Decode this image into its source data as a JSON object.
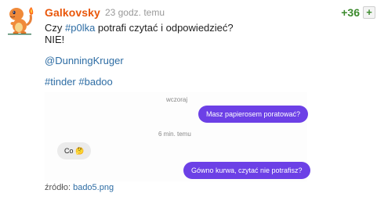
{
  "post": {
    "username": "Galkovsky",
    "time": "23 godz. temu",
    "votes": "+36",
    "plus_label": "+",
    "body": {
      "line1_prefix": "Czy ",
      "line1_tag": "#p0lka",
      "line1_suffix": " potrafi czytać i odpowiedzieć?",
      "line2": "NIE!",
      "mention": "@DunningKruger",
      "tag1": "#tinder",
      "tag2": "#badoo"
    },
    "image": {
      "day_label_1": "wczoraj",
      "message_out_1": "Masz papierosem poratować?",
      "day_label_2": "6 min. temu",
      "message_in_1": "Co 🤔",
      "message_out_2": "Gówno kurwa, czytać nie potrafisz?"
    },
    "source_label": "źródło: ",
    "source_file": "bado5.png"
  },
  "colors": {
    "username": "#e9570b",
    "votes": "#3b8a2c",
    "link": "#2e6da4",
    "bubble_out": "#6c40e6",
    "bubble_in": "#ebebeb"
  }
}
